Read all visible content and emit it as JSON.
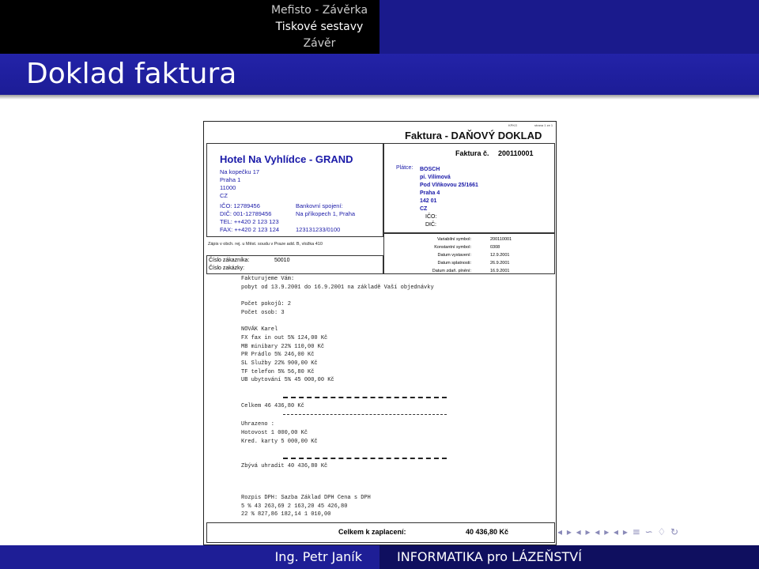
{
  "nav": [
    "Mefisto - Závěrka",
    "Tiskové sestavy",
    "Závěr"
  ],
  "slide_title": "Doklad faktura",
  "footer": {
    "author": "Ing. Petr Janík",
    "course": "INFORMATIKA pro LÁZEŇSTVÍ"
  },
  "nav_symbols": "◂ ▸ ◂ ▸ ◂ ▸ ◂ ▸ ≡ ∽ ♢ ↻",
  "invoice": {
    "small_a": "KPKO",
    "small_b": "strana 1 ze 1",
    "doc_title": "Faktura - DAŇOVÝ DOKLAD",
    "number_label": "Faktura č.",
    "number": "200110001",
    "hotel_name": "Hotel Na Vyhlídce - GRAND",
    "hotel_addr": [
      "Na kopečku 17",
      "Praha 1",
      "11000",
      "CZ"
    ],
    "hotel_ids": [
      "IČO:  12789456",
      "DIČ:  001-12789456",
      "TEL:  ++420 2 123 123",
      "FAX:  ++420 2 123 124"
    ],
    "bank_label": "Bankovní spojení:",
    "bank_lines": [
      "Na příkopech 1, Praha",
      "",
      "123131233/0100"
    ],
    "registry": "Zápis v obch. rej. u Měst. soudu v Praze add. B, vložka 410",
    "customer_no_label": "Číslo zákazníka:",
    "customer_no": "50010",
    "order_no_label": "Číslo zakázky:",
    "payer_label": "Plátce:",
    "payer_lines": [
      "BOSCH",
      "pí. Vilímová",
      "Pod Vlňkovou 25/1661",
      "Praha 4",
      "142 01",
      "CZ"
    ],
    "payer_ico": "IČO:",
    "payer_dic": "DIČ:",
    "symbols": [
      {
        "label": "Variabilní symbol:",
        "value": "200110001"
      },
      {
        "label": "Konstantní symbol:",
        "value": "0308"
      },
      {
        "label": "Datum vystavení:",
        "value": "12.9.2001"
      },
      {
        "label": "Datum splatnosti:",
        "value": "26.9.2001"
      },
      {
        "label": "Datum zdaň. plnění:",
        "value": "16.9.2001"
      }
    ],
    "body_lines": [
      "Fakturujeme Vám:",
      "pobyt od 13.9.2001 do 16.9.2001 na základě Vaší objednávky",
      "",
      "          Počet pokojů:     2",
      "          Počet osob:       3",
      "",
      "   NOVÁK Karel",
      "          FX  fax in out        5%     124,00 Kč",
      "          MB  minibary         22%     110,00 Kč",
      "          PR  Prádlo            5%     246,00 Kč",
      "          SL  Služby           22%     900,00 Kč",
      "          TF  telefon           5%      56,80 Kč",
      "          UB  ubytování         5%   45 000,00 Kč"
    ],
    "total_line": "          Celkem       46 436,80 Kč",
    "paid_lines": [
      "Uhrazeno :",
      "          Hotovost                    1 000,00 Kč",
      "          Kred. karty                 5 000,00 Kč"
    ],
    "remaining_line": "          Zbývá uhradit              40 436,80 Kč",
    "vat_lines": [
      "Rozpis DPH: Sazba         Základ         DPH        Cena s DPH",
      "              5 %      43 263,69      2 163,20      45 426,80",
      "             22 %         827,86        182,14       1 010,00"
    ],
    "grand_total_label": "Celkem k zaplacení:",
    "grand_total": "40 436,80 Kč"
  }
}
